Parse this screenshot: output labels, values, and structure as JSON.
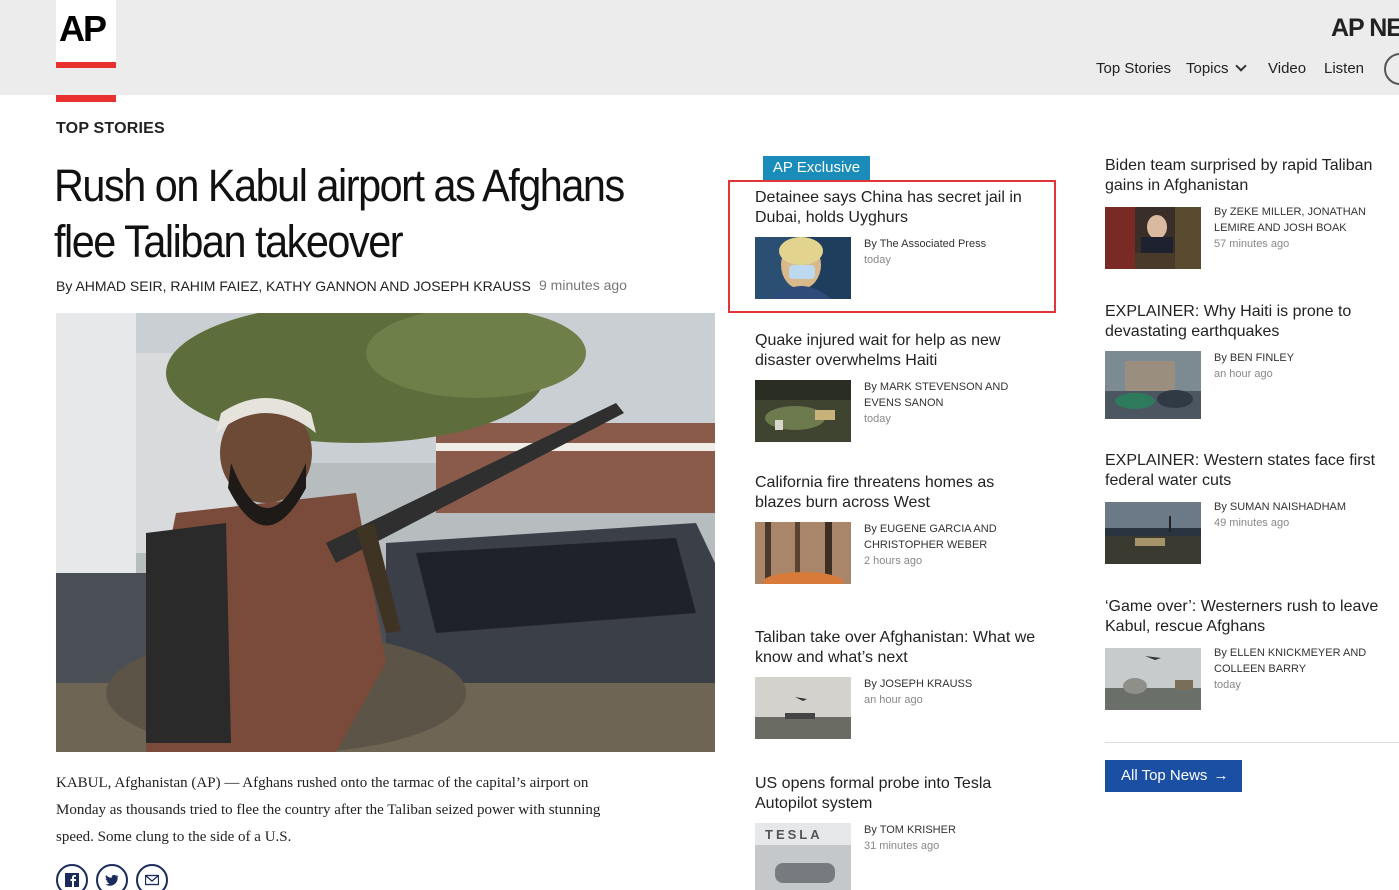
{
  "header": {
    "logo": "AP",
    "brand_right": "AP NEWS",
    "nav": [
      {
        "label": "Top Stories"
      },
      {
        "label": "Topics"
      },
      {
        "label": "Video"
      },
      {
        "label": "Listen"
      }
    ]
  },
  "section_label": "TOP STORIES",
  "main_story": {
    "headline": "Rush on Kabul airport as Afghans flee Taliban takeover",
    "byline": "By AHMAD SEIR, RAHIM FAIEZ, KATHY GANNON AND JOSEPH KRAUSS",
    "time": "9 minutes ago",
    "summary": "KABUL, Afghanistan (AP) — Afghans rushed onto the tarmac of the capital’s airport on Monday as thousands tried to flee the country after the Taliban seized power with stunning speed. Some clung to the side of a U.S."
  },
  "middle_column": [
    {
      "badge": "AP Exclusive",
      "title": "Detainee says China has secret jail in Dubai, holds Uyghurs",
      "by": "By",
      "authors": "The Associated Press",
      "time": "today"
    },
    {
      "title": "Quake injured wait for help as new disaster overwhelms Haiti",
      "by": "By",
      "authors": "MARK STEVENSON and EVENS SANON",
      "time": "today"
    },
    {
      "title": "California fire threatens homes as blazes burn across West",
      "by": "By",
      "authors": "EUGENE GARCIA and CHRISTOPHER WEBER",
      "time": "2 hours ago"
    },
    {
      "title": "Taliban take over Afghanistan: What we know and what’s next",
      "by": "By",
      "authors": "JOSEPH KRAUSS",
      "time": "an hour ago"
    },
    {
      "title": "US opens formal probe into Tesla Autopilot system",
      "by": "By",
      "authors": "TOM KRISHER",
      "time": "31 minutes ago"
    }
  ],
  "right_column": [
    {
      "title": "Biden team surprised by rapid Taliban gains in Afghanistan",
      "by": "By",
      "authors": "ZEKE MILLER, JONATHAN LEMIRE and JOSH BOAK",
      "time": "57 minutes ago"
    },
    {
      "title": "EXPLAINER: Why Haiti is prone to devastating earthquakes",
      "by": "By",
      "authors": "BEN FINLEY",
      "time": "an hour ago"
    },
    {
      "title": "EXPLAINER: Western states face first federal water cuts",
      "by": "By",
      "authors": "SUMAN NAISHADHAM",
      "time": "49 minutes ago"
    },
    {
      "title": "‘Game over’: Westerners rush to leave Kabul, rescue Afghans",
      "by": "By",
      "authors": "ELLEN KNICKMEYER and COLLEEN BARRY",
      "time": "today"
    }
  ],
  "all_top_news": "All Top News",
  "thumb_text": {
    "tesla": "TESLA"
  },
  "colors": {
    "header_bg": "#ececec",
    "ap_red": "#e8312f",
    "badge_blue": "#1a8cb9",
    "button_blue": "#1a4fa3",
    "highlight_red": "#e0363a"
  }
}
